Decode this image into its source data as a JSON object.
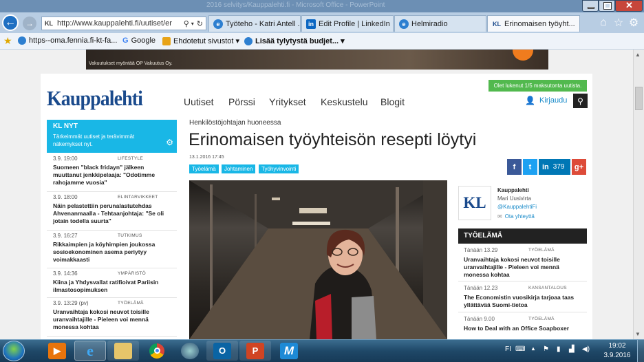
{
  "browser": {
    "window_title": "2016 selvitys/Kauppalehti.fi - Microsoft Office - PowerPoint",
    "url": "http://www.kauppalehti.fi/uutiset/er",
    "url_site_badge": "KL",
    "tabs": [
      {
        "label": "Työteho - Katri Antell ..."
      },
      {
        "label": "Edit Profile | LinkedIn"
      },
      {
        "label": "Helmiradio"
      },
      {
        "label": "Erinomaisen työyht..."
      }
    ],
    "favorites": [
      {
        "label": "https--oma.fennia.fi-kt-fa..."
      },
      {
        "label": "Google"
      },
      {
        "label": "Ehdotetut sivustot ▾"
      },
      {
        "label": "Lisää tylytystä budjet... ▾"
      }
    ]
  },
  "ad": {
    "disclaimer": "Vakuutukset myöntää OP Vakuutus Oy."
  },
  "site": {
    "logo": "Kauppalehti",
    "nav": [
      "Uutiset",
      "Pörssi",
      "Yritykset",
      "Keskustelu",
      "Blogit"
    ],
    "read_counter": "Olet lukenut 1/5 maksutonta uutista.",
    "login": "Kirjaudu"
  },
  "sidebar": {
    "title": "KL NYT",
    "description": "Tärkeimmät uutiset ja terävimmät näkemykset nyt.",
    "items": [
      {
        "time": "3.9. 19:00",
        "category": "LIFESTYLE",
        "headline": "Suomeen \"black fridayn\" jälkeen muuttanut jenkkipelaaja: \"Odotimme rahojamme vuosia\""
      },
      {
        "time": "3.9. 18:00",
        "category": "ELINTARVIKKEET",
        "headline": "Näin pelastettiin perunalastutehdas Ahvenanmaalla - Tehtaanjohtaja: \"Se oli jotain todella suurta\""
      },
      {
        "time": "3.9. 16:27",
        "category": "TUTKIMUS",
        "headline": "Rikkaimpien ja köyhimpien joukossa sosioekonominen asema periytyy voimakkaasti"
      },
      {
        "time": "3.9. 14:36",
        "category": "YMPÄRISTÖ",
        "headline": "Kiina ja Yhdysvallat ratifioivat Pariisin ilmastosopimuksen"
      },
      {
        "time": "3.9. 13:29 (pv)",
        "category": "TYÖELÄMÄ",
        "headline": "Uranvaihtaja kokosi neuvot toisille uranvaihtajille - Pieleen voi mennä monessa kohtaa"
      }
    ]
  },
  "article": {
    "kicker": "Henkilöstöjohtajan huoneessa",
    "headline": "Erinomaisen työyhteisön resepti löytyi",
    "date": "13.1.2016 17:45",
    "tags": [
      "Työelämä",
      "Johtaminen",
      "Työhyvinvointi"
    ],
    "share": {
      "facebook": "f",
      "twitter": "t",
      "linkedin": "in",
      "linkedin_count": "379",
      "googleplus": "g+"
    }
  },
  "author": {
    "logo": "KL",
    "publication": "Kauppalehti",
    "name": "Mari Uusivirta",
    "handle": "@KauppalehtiFi",
    "contact": "Ota yhteyttä"
  },
  "right_list": {
    "title": "TYÖELÄMÄ",
    "items": [
      {
        "time": "Tänään 13.29",
        "category": "TYÖELÄMÄ",
        "headline": "Uranvaihtaja kokosi neuvot toisille uranvaihtajille - Pieleen voi mennä monessa kohtaa"
      },
      {
        "time": "Tänään 12.23",
        "category": "KANSANTALOUS",
        "headline": "The Economistin vuosikirja tarjoaa taas yllättävää Suomi-tietoa"
      },
      {
        "time": "Tänään 9.00",
        "category": "TYÖELÄMÄ",
        "headline": "How to Deal with an Office Soapboxer"
      }
    ]
  },
  "taskbar": {
    "language": "FI",
    "time": "19:02",
    "date": "3.9.2016"
  },
  "colors": {
    "accent": "#19b7e6",
    "brand": "#1a4a8c",
    "counter": "#52b94e"
  }
}
